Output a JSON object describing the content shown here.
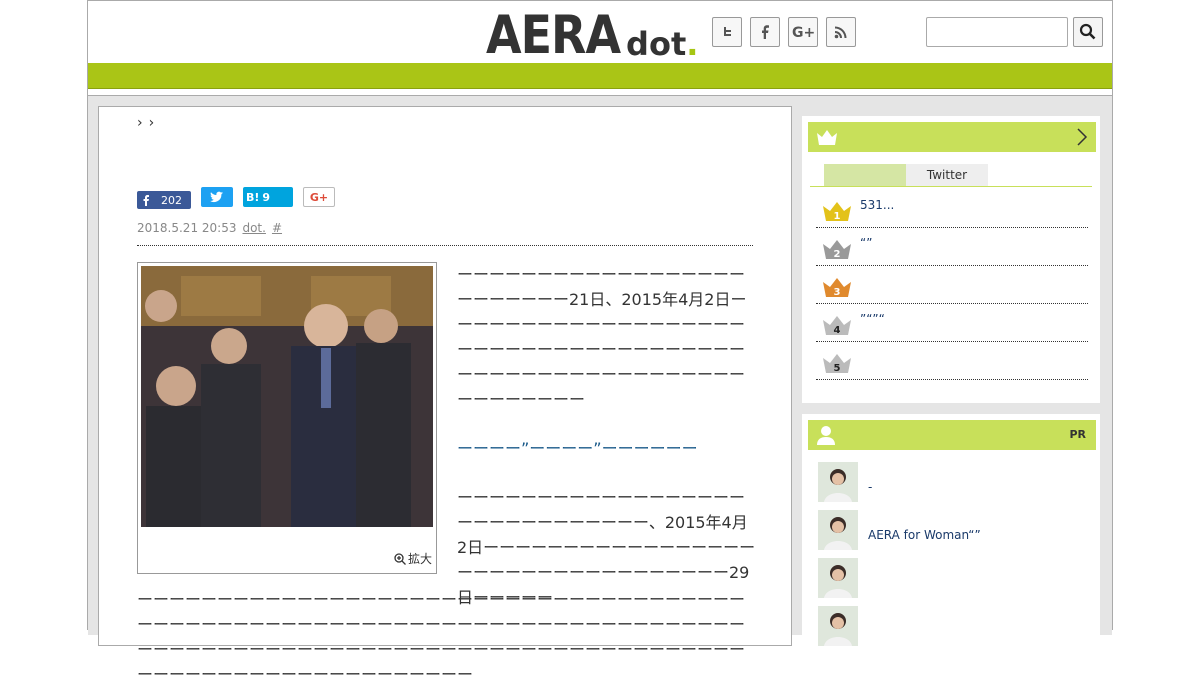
{
  "brand": {
    "aera": "AERA",
    "dot_text": "dot",
    "dot_period": "."
  },
  "breadcrumb": [
    "›",
    "›"
  ],
  "share": {
    "fb_count": "202",
    "hatena_label": "B!",
    "hatena_count": "9",
    "gplus_label": "G+"
  },
  "meta": {
    "datetime": "2018.5.21 20:53",
    "source": "dot.",
    "hash": "#"
  },
  "photo": {
    "zoom_label": "拡大"
  },
  "article": {
    "para1": "ーーーーーーーーーーーーーーーーーーーーーーーーー21日、2015年4月2日ーーーーーーーーーーーーーーーーーーーーーーーーーーーーーーーーーーーーーーーーーーーーーーーーーーーーーーーーーーーーーーー",
    "subhead": "ーーーー”ーーーー”ーーーーーー",
    "para2": "ーーーーーーーーーーーーーーーーーーーーーーーーーーーーーー、2015年4月2日ーーーーーーーーーーーーーーーーーーーーーーーーーーーーーーーーーー29日ーーーーー",
    "para3": "ーーーーーーーーーーーーーーーーーーーーーーーーーーーーーーーーーーーーーーーーーーーーーーーーーーーーーーーーーーーーーーーーーーーーーーーーーーーーーーーーーーーーーーーーーーーーーーーーーーーーーーーーーーーーーーーーーーーーーーーーーーーーーーーーーーーーーーー"
  },
  "ranking": {
    "tabs": [
      "",
      "Twitter"
    ],
    "items": [
      {
        "num": "1",
        "text": "531..."
      },
      {
        "num": "2",
        "text": "“”"
      },
      {
        "num": "3",
        "text": ""
      },
      {
        "num": "4",
        "text": "”“”“"
      },
      {
        "num": "5",
        "text": ""
      }
    ],
    "colors": [
      "#e3c21a",
      "#9a9a9a",
      "#e08a2e",
      "#bbbbbb",
      "#bbbbbb"
    ]
  },
  "pr": {
    "label": "PR",
    "items": [
      {
        "text": "-"
      },
      {
        "text": "AERA for Woman“”"
      },
      {
        "text": ""
      },
      {
        "text": ""
      }
    ]
  },
  "colors": {
    "accent": "#aac516",
    "accent_light": "#c8e05a"
  }
}
